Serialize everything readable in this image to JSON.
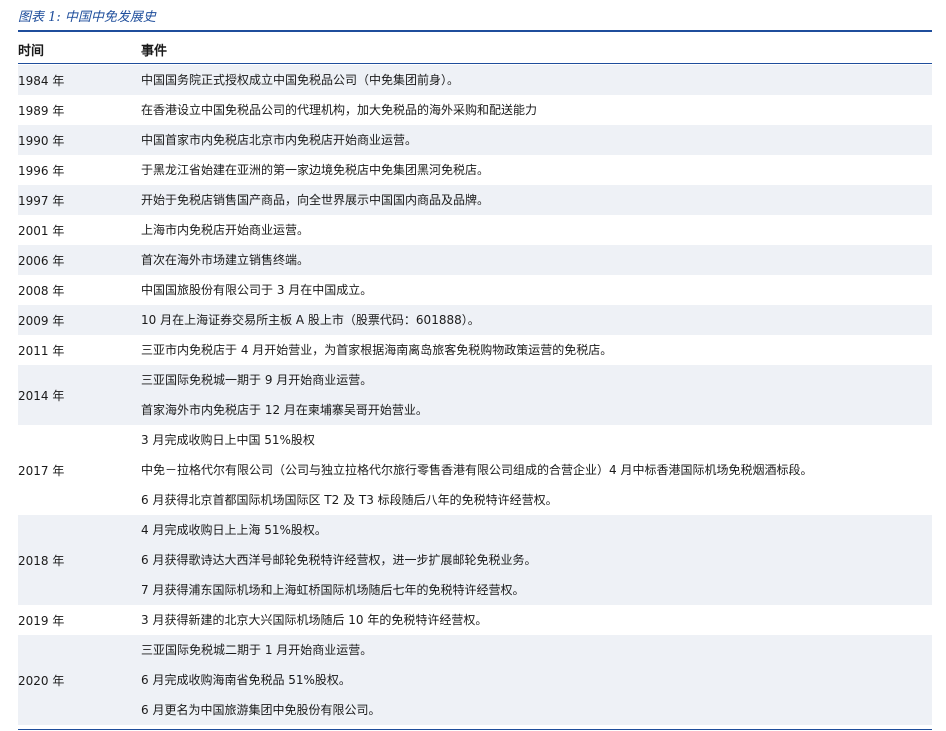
{
  "caption": "图表 1: 中国中免发展史",
  "header": {
    "time": "时间",
    "event": "事件"
  },
  "rows": [
    {
      "year": "1984 年",
      "events": [
        "中国国务院正式授权成立中国免税品公司（中免集团前身）。"
      ]
    },
    {
      "year": "1989 年",
      "events": [
        "在香港设立中国免税品公司的代理机构，加大免税品的海外采购和配送能力"
      ]
    },
    {
      "year": "1990 年",
      "events": [
        "中国首家市内免税店北京市内免税店开始商业运营。"
      ]
    },
    {
      "year": "1996 年",
      "events": [
        "于黑龙江省始建在亚洲的第一家边境免税店中免集团黑河免税店。"
      ]
    },
    {
      "year": "1997 年",
      "events": [
        "开始于免税店销售国产商品，向全世界展示中国国内商品及品牌。"
      ]
    },
    {
      "year": "2001 年",
      "events": [
        "上海市内免税店开始商业运营。"
      ]
    },
    {
      "year": "2006 年",
      "events": [
        "首次在海外市场建立销售终端。"
      ]
    },
    {
      "year": "2008 年",
      "events": [
        "中国国旅股份有限公司于 3 月在中国成立。"
      ]
    },
    {
      "year": "2009 年",
      "events": [
        "10 月在上海证券交易所主板 A 股上市（股票代码：601888）。"
      ]
    },
    {
      "year": "2011 年",
      "events": [
        "三亚市内免税店于 4 月开始营业，为首家根据海南离岛旅客免税购物政策运营的免税店。"
      ]
    },
    {
      "year": "2014 年",
      "events": [
        "三亚国际免税城一期于 9 月开始商业运营。",
        "首家海外市内免税店于 12 月在柬埔寨吴哥开始营业。"
      ]
    },
    {
      "year": "2017 年",
      "events": [
        "3 月完成收购日上中国 51%股权",
        "中免－拉格代尔有限公司（公司与独立拉格代尔旅行零售香港有限公司组成的合营企业）4 月中标香港国际机场免税烟酒标段。",
        "6 月获得北京首都国际机场国际区 T2 及 T3 标段随后八年的免税特许经营权。"
      ]
    },
    {
      "year": "2018 年",
      "events": [
        "4 月完成收购日上上海 51%股权。",
        "6 月获得歌诗达大西洋号邮轮免税特许经营权，进一步扩展邮轮免税业务。",
        "7 月获得浦东国际机场和上海虹桥国际机场随后七年的免税特许经营权。"
      ]
    },
    {
      "year": "2019 年",
      "events": [
        "3 月获得新建的北京大兴国际机场随后 10 年的免税特许经营权。"
      ]
    },
    {
      "year": "2020 年",
      "events": [
        "三亚国际免税城二期于 1 月开始商业运营。",
        "6 月完成收购海南省免税品 51%股权。",
        "6 月更名为中国旅游集团中免股份有限公司。"
      ]
    }
  ]
}
